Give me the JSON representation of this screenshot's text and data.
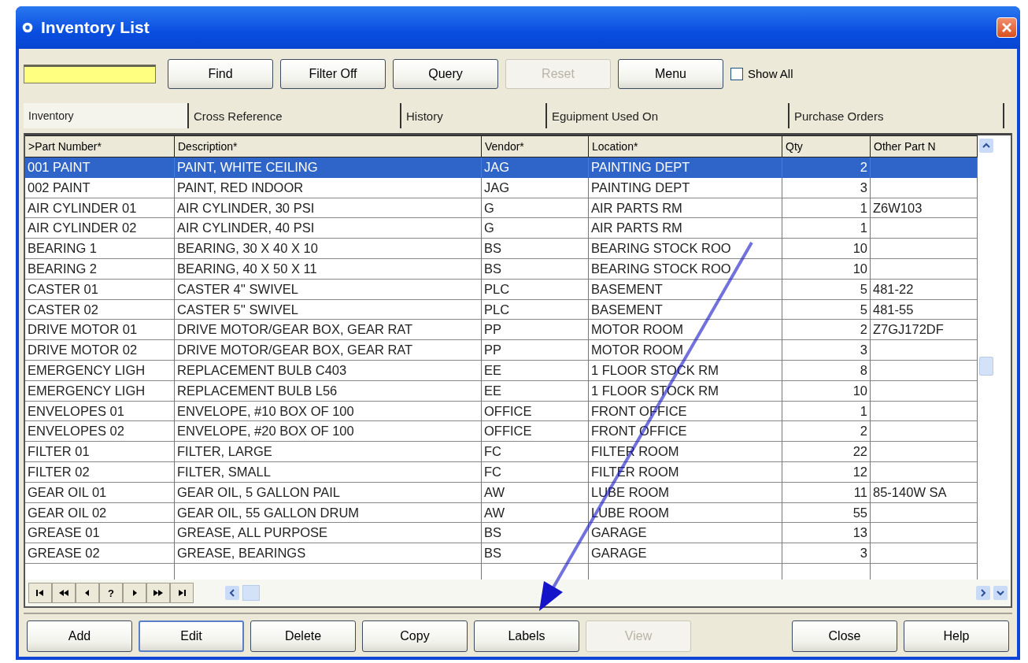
{
  "window": {
    "title": "Inventory List"
  },
  "toolbar": {
    "buttons": [
      {
        "label": "Find",
        "disabled": false
      },
      {
        "label": "Filter Off",
        "disabled": false
      },
      {
        "label": "Query",
        "disabled": false
      },
      {
        "label": "Reset",
        "disabled": true
      },
      {
        "label": "Menu",
        "disabled": false
      }
    ],
    "show_all": {
      "label": "Show All",
      "checked": false
    }
  },
  "tabs": [
    {
      "label": "Inventory",
      "selected": true
    },
    {
      "label": "Cross Reference",
      "selected": false
    },
    {
      "label": "History",
      "selected": false
    },
    {
      "label": "Eguipment Used On",
      "selected": false
    },
    {
      "label": "Purchase Orders",
      "selected": false
    }
  ],
  "table": {
    "columns": [
      ">Part Number*",
      "Description*",
      "Vendor*",
      "Location*",
      "Qty",
      "Other Part N"
    ],
    "rows": [
      {
        "cells": [
          "001 PAINT",
          "PAINT, WHITE CEILING",
          "JAG",
          "PAINTING DEPT",
          "2",
          ""
        ],
        "selected": true
      },
      {
        "cells": [
          "002 PAINT",
          "PAINT, RED INDOOR",
          "JAG",
          "PAINTING DEPT",
          "3",
          ""
        ],
        "selected": false
      },
      {
        "cells": [
          "AIR CYLINDER 01",
          "AIR CYLINDER, 30 PSI",
          "G",
          "AIR PARTS RM",
          "1",
          "Z6W103"
        ],
        "selected": false
      },
      {
        "cells": [
          "AIR CYLINDER 02",
          "AIR CYLINDER, 40 PSI",
          "G",
          "AIR PARTS RM",
          "1",
          ""
        ],
        "selected": false
      },
      {
        "cells": [
          "BEARING 1",
          "BEARING, 30 X 40 X 10",
          "BS",
          "BEARING STOCK ROO",
          "10",
          ""
        ],
        "selected": false
      },
      {
        "cells": [
          "BEARING 2",
          "BEARING, 40 X 50 X 11",
          "BS",
          "BEARING STOCK ROO",
          "10",
          ""
        ],
        "selected": false
      },
      {
        "cells": [
          "CASTER 01",
          "CASTER 4'' SWIVEL",
          "PLC",
          "BASEMENT",
          "5",
          "481-22"
        ],
        "selected": false
      },
      {
        "cells": [
          "CASTER 02",
          "CASTER 5'' SWIVEL",
          "PLC",
          "BASEMENT",
          "5",
          "481-55"
        ],
        "selected": false
      },
      {
        "cells": [
          "DRIVE MOTOR 01",
          "DRIVE MOTOR/GEAR BOX, GEAR RAT",
          "PP",
          "MOTOR ROOM",
          "2",
          "Z7GJ172DF"
        ],
        "selected": false
      },
      {
        "cells": [
          "DRIVE MOTOR 02",
          "DRIVE MOTOR/GEAR BOX, GEAR RAT",
          "PP",
          "MOTOR ROOM",
          "3",
          ""
        ],
        "selected": false
      },
      {
        "cells": [
          "EMERGENCY LIGH",
          "REPLACEMENT BULB C403",
          "EE",
          "1 FLOOR STOCK RM",
          "8",
          ""
        ],
        "selected": false
      },
      {
        "cells": [
          "EMERGENCY LIGH",
          "REPLACEMENT BULB L56",
          "EE",
          "1 FLOOR STOCK RM",
          "10",
          ""
        ],
        "selected": false
      },
      {
        "cells": [
          "ENVELOPES 01",
          "ENVELOPE, #10 BOX OF 100",
          "OFFICE",
          "FRONT OFFICE",
          "1",
          ""
        ],
        "selected": false
      },
      {
        "cells": [
          "ENVELOPES 02",
          "ENVELOPE, #20 BOX OF 100",
          "OFFICE",
          "FRONT OFFICE",
          "2",
          ""
        ],
        "selected": false
      },
      {
        "cells": [
          "FILTER 01",
          "FILTER, LARGE",
          "FC",
          "FILTER ROOM",
          "22",
          ""
        ],
        "selected": false
      },
      {
        "cells": [
          "FILTER 02",
          "FILTER, SMALL",
          "FC",
          "FILTER ROOM",
          "12",
          ""
        ],
        "selected": false
      },
      {
        "cells": [
          "GEAR OIL 01",
          "GEAR OIL,  5 GALLON PAIL",
          "AW",
          "LUBE ROOM",
          "11",
          "85-140W SA"
        ],
        "selected": false
      },
      {
        "cells": [
          "GEAR OIL 02",
          "GEAR OIL, 55 GALLON DRUM",
          "AW",
          "LUBE ROOM",
          "55",
          ""
        ],
        "selected": false
      },
      {
        "cells": [
          "GREASE 01",
          "GREASE,  ALL PURPOSE",
          "BS",
          "GARAGE",
          "13",
          ""
        ],
        "selected": false
      },
      {
        "cells": [
          "GREASE 02",
          "GREASE,  BEARINGS",
          "BS",
          "GARAGE",
          "3",
          ""
        ],
        "selected": false
      }
    ]
  },
  "record_nav": {
    "help_label": "?"
  },
  "footer_buttons": [
    {
      "label": "Add",
      "disabled": false,
      "selected": false
    },
    {
      "label": "Edit",
      "disabled": false,
      "selected": true
    },
    {
      "label": "Delete",
      "disabled": false,
      "selected": false
    },
    {
      "label": "Copy",
      "disabled": false,
      "selected": false
    },
    {
      "label": "Labels",
      "disabled": false,
      "selected": false
    },
    {
      "label": "View",
      "disabled": true,
      "selected": false
    },
    {
      "label": "Close",
      "disabled": false,
      "selected": false
    },
    {
      "label": "Help",
      "disabled": false,
      "selected": false
    }
  ]
}
